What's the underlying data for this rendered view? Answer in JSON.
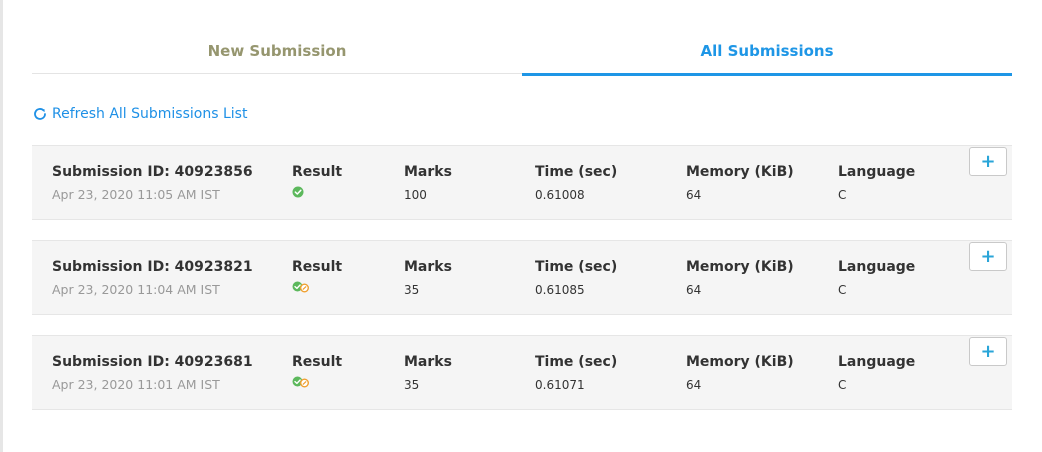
{
  "tabs": [
    {
      "label": "New Submission",
      "active": false
    },
    {
      "label": "All Submissions",
      "active": true
    }
  ],
  "refresh": {
    "label": "Refresh All Submissions List",
    "icon": "refresh-icon"
  },
  "headers": {
    "result": "Result",
    "marks": "Marks",
    "time": "Time (sec)",
    "memory": "Memory (KiB)",
    "language": "Language"
  },
  "submissions": [
    {
      "id_label": "Submission ID: 40923856",
      "date": "Apr 23, 2020 11:05 AM IST",
      "result_icon": "accepted-check-icon",
      "marks": "100",
      "time": "0.61008",
      "memory": "64",
      "language": "C"
    },
    {
      "id_label": "Submission ID: 40923821",
      "date": "Apr 23, 2020 11:04 AM IST",
      "result_icon": "partial-accepted-icon",
      "marks": "35",
      "time": "0.61085",
      "memory": "64",
      "language": "C"
    },
    {
      "id_label": "Submission ID: 40923681",
      "date": "Apr 23, 2020 11:01 AM IST",
      "result_icon": "partial-accepted-icon",
      "marks": "35",
      "time": "0.61071",
      "memory": "64",
      "language": "C"
    }
  ],
  "expand_button": {
    "label": "+",
    "icon": "plus-icon"
  },
  "colors": {
    "accent": "#1e96e6",
    "inactive_tab": "#96966f",
    "success": "#5cb85c",
    "warning": "#f0a030",
    "row_bg": "#f5f5f5"
  }
}
